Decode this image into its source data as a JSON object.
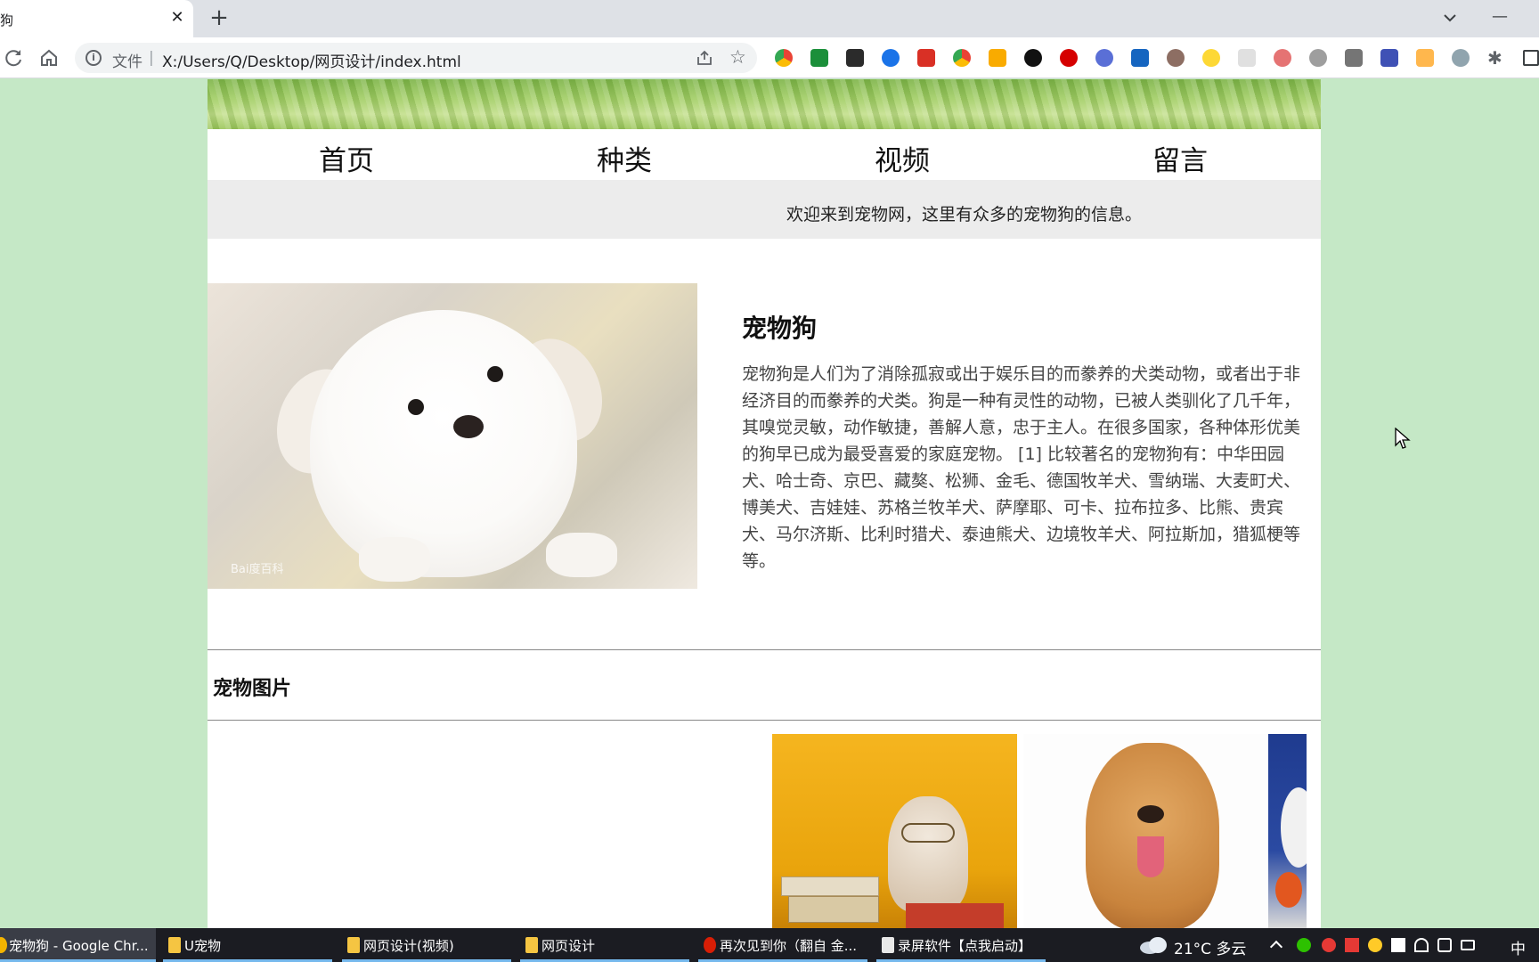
{
  "browser": {
    "tab_title": "宠物狗",
    "tab_close": "✕",
    "new_tab": "+",
    "window_min": "—",
    "address_label": "文件",
    "address_sep": "|",
    "url": "X:/Users/Q/Desktop/网页设计/index.html",
    "star_icon": "☆",
    "puzzle_icon": "✱"
  },
  "page": {
    "nav": [
      "首页",
      "种类",
      "视频",
      "留言"
    ],
    "welcome": "欢迎来到宠物网，这里有众多的宠物狗的信息。",
    "hero_watermark": "Bai度百科",
    "section_title": "宠物狗",
    "description": "宠物狗是人们为了消除孤寂或出于娱乐目的而豢养的犬类动物，或者出于非经济目的而豢养的犬类。狗是一种有灵性的动物，已被人类驯化了几千年，其嗅觉灵敏，动作敏捷，善解人意，忠于主人。在很多国家，各种体形优美的狗早已成为最受喜爱的家庭宠物。 [1] 比较著名的宠物狗有：中华田园犬、哈士奇、京巴、藏獒、松狮、金毛、德国牧羊犬、雪纳瑞、大麦町犬、博美犬、吉娃娃、苏格兰牧羊犬、萨摩耶、可卡、拉布拉多、比熊、贵宾犬、马尔济斯、比利时猎犬、泰迪熊犬、边境牧羊犬、阿拉斯加，猎狐梗等等。",
    "gallery_title": "宠物图片"
  },
  "taskbar": {
    "items": [
      {
        "label": "宠物狗 - Google Chr...",
        "icon_color": "#f4b400"
      },
      {
        "label": "U宠物",
        "icon_color": "#f5c542"
      },
      {
        "label": "网页设计(视频)",
        "icon_color": "#f5c542"
      },
      {
        "label": "网页设计",
        "icon_color": "#f5c542"
      },
      {
        "label": "再次见到你（翻自 金...",
        "icon_color": "#d81e06"
      },
      {
        "label": "录屏软件【点我启动】",
        "icon_color": "#e8e8e8"
      }
    ],
    "weather": "21°C  多云",
    "ime": "中"
  },
  "colors": {
    "page_bg": "#c5e8c6",
    "content_bg": "#ffffff",
    "welcome_bg": "#ececec",
    "taskbar_bg": "#1b1c22"
  }
}
